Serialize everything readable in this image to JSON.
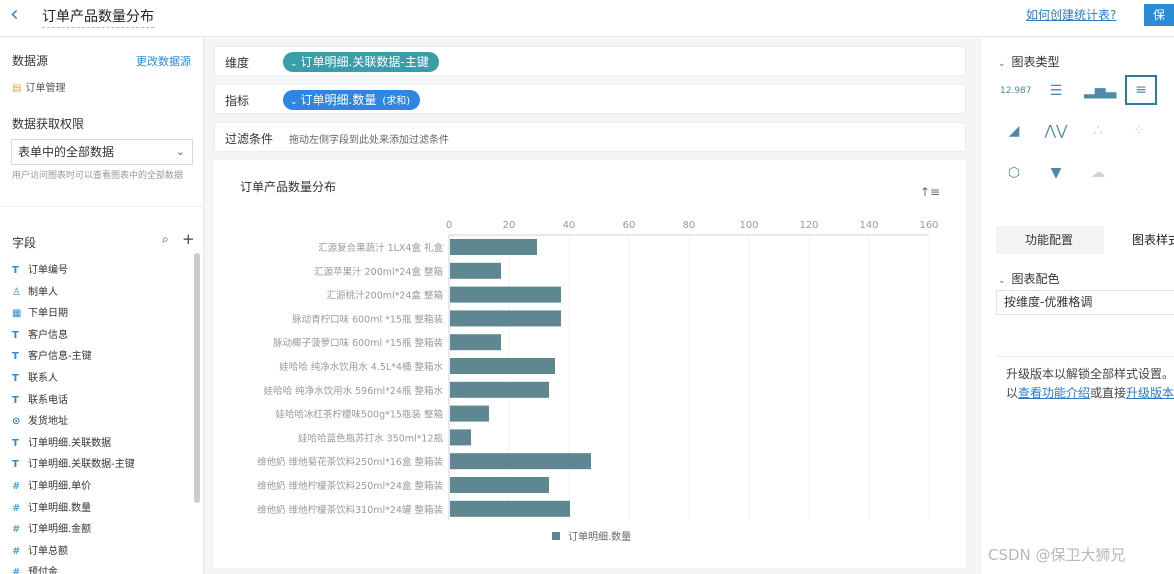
{
  "header": {
    "back_icon": "chevron-left-icon",
    "title": "订单产品数量分布",
    "help_link": "如何创建统计表?",
    "save_label": "保"
  },
  "left": {
    "datasource_label": "数据源",
    "change_datasource": "更改数据源",
    "datasource_name": "订单管理",
    "permission_label": "数据获取权限",
    "permission_value": "表单中的全部数据",
    "permission_hint": "用户访问图表时可以查看图表中的全部数据",
    "fields_label": "字段",
    "fields": [
      {
        "type": "T",
        "name": "订单编号"
      },
      {
        "type": "user",
        "name": "制单人"
      },
      {
        "type": "date",
        "name": "下单日期"
      },
      {
        "type": "T",
        "name": "客户信息"
      },
      {
        "type": "T",
        "name": "客户信息-主键"
      },
      {
        "type": "T",
        "name": "联系人"
      },
      {
        "type": "T",
        "name": "联系电话"
      },
      {
        "type": "loc",
        "name": "发货地址"
      },
      {
        "type": "T",
        "name": "订单明细.关联数据"
      },
      {
        "type": "T",
        "name": "订单明细.关联数据-主键"
      },
      {
        "type": "#",
        "name": "订单明细.单价"
      },
      {
        "type": "#",
        "name": "订单明细.数量"
      },
      {
        "type": "#",
        "name": "订单明细.金额"
      },
      {
        "type": "#",
        "name": "订单总额"
      },
      {
        "type": "#",
        "name": "预付金"
      }
    ]
  },
  "config": {
    "dimension_label": "维度",
    "dimension_value": "订单明细.关联数据-主键",
    "metric_label": "指标",
    "metric_value": "订单明细.数量",
    "metric_agg": "(求和)",
    "filter_label": "过滤条件",
    "filter_hint": "拖动左侧字段到此处来添加过滤条件"
  },
  "chart_data": {
    "type": "bar",
    "orientation": "horizontal",
    "title": "订单产品数量分布",
    "categories": [
      "汇源复合果蔬汁 1LX4盒 礼盒",
      "汇源苹果汁 200ml*24盒 整箱",
      "汇源桃汁200ml*24盒 整箱",
      "脉动青柠口味 600ml *15瓶 整箱装",
      "脉动椰子菠萝口味 600ml *15瓶 整箱装",
      "娃哈哈 纯净水饮用水 4.5L*4桶 整箱水",
      "娃哈哈 纯净水饮用水 596ml*24瓶 整箱水",
      "娃哈哈冰红茶柠檬味500g*15瓶装 整箱",
      "娃哈哈蓝色瓶苏打水 350ml*12瓶",
      "维他奶 维他菊花茶饮料250ml*16盒 整箱装",
      "维他奶 维他柠檬茶饮料250ml*24盒 整箱装",
      "维他奶 维他柠檬茶饮料310ml*24罐 整箱装"
    ],
    "series": [
      {
        "name": "订单明细.数量",
        "values": [
          29,
          17,
          37,
          37,
          17,
          35,
          33,
          13,
          7,
          47,
          33,
          40
        ]
      }
    ],
    "xlim": [
      0,
      160
    ],
    "xticks": [
      0,
      20,
      40,
      60,
      80,
      100,
      120,
      140,
      160
    ],
    "legend_position": "bottom",
    "bar_color": "#5f8791"
  },
  "right": {
    "chart_type_label": "图表类型",
    "chart_types": [
      "number-card-icon",
      "table-icon",
      "column-chart-icon",
      "bar-chart-icon",
      "area-chart-icon",
      "combo-chart-icon",
      "scatter-icon",
      "bubble-icon",
      "radar-icon",
      "funnel-icon",
      "map-icon"
    ],
    "tab_function": "功能配置",
    "tab_style": "图表样式",
    "color_label": "图表配色",
    "color_value": "按维度-优雅格调",
    "upgrade_text1": "升级版本以解锁全部样式设置。您可",
    "upgrade_text2": "以",
    "upgrade_link1": "查看功能介绍",
    "upgrade_text3": "或直接",
    "upgrade_link2": "升级版本",
    "upgrade_text4": "。"
  },
  "watermark": "CSDN @保卫大狮兄",
  "colors": {
    "accent": "#2a8cd6",
    "dimension_pill": "#3a9ea8",
    "metric_pill": "#2f86e0"
  }
}
